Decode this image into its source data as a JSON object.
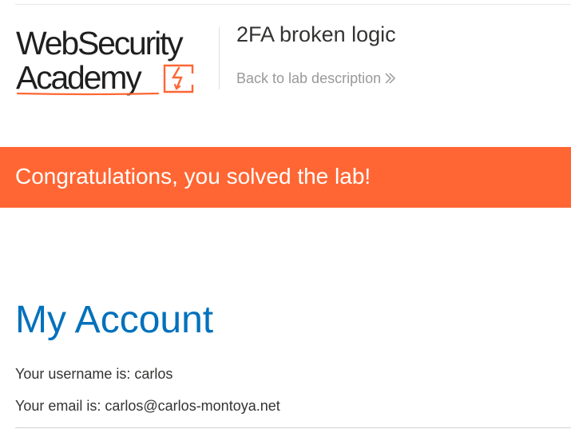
{
  "header": {
    "logo": {
      "line1": "WebSecurity",
      "line2": "Academy",
      "icon": "lightning-bolt-box-icon",
      "accent_color": "#ff6633"
    },
    "lab_title": "2FA broken logic",
    "back_link_label": "Back to lab description",
    "back_link_icon": "double-chevron-right-icon"
  },
  "banner": {
    "text": "Congratulations, you solved the lab!",
    "color": "#ff6633"
  },
  "account": {
    "title": "My Account",
    "username_line": "Your username is: carlos",
    "email_line": "Your email is: carlos@carlos-montoya.net",
    "title_color": "#0071bc"
  }
}
